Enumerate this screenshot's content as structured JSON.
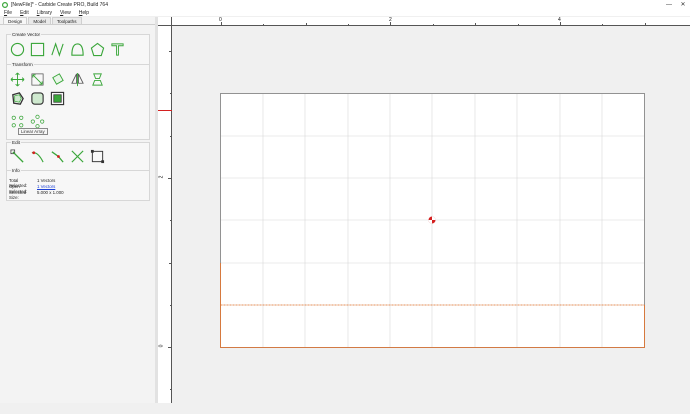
{
  "window": {
    "title": "[NewFile]* - Carbide Create PRO, Build 764",
    "minimize_icon": "minimize-icon",
    "close_icon": "close-icon",
    "minimize_glyph": "—",
    "close_glyph": "✕"
  },
  "menu": {
    "items": [
      "File",
      "Edit",
      "Library",
      "View",
      "Help"
    ]
  },
  "tabs": [
    "Design",
    "Model",
    "Toolpaths"
  ],
  "sections": {
    "create_vector": "Create Vector",
    "transform": "Transform",
    "edit": "Edit",
    "info": "Info"
  },
  "tooltip": "Linear Array",
  "info": {
    "rows": [
      {
        "label": "Total Selected:",
        "value": "1 Vectors"
      },
      {
        "label": "Open Selected:",
        "value": "1 Vectors"
      },
      {
        "label": "Selected Size:",
        "value": "5.000 x 1.000"
      }
    ]
  },
  "ruler": {
    "top_labels": [
      "0",
      "2",
      "4"
    ],
    "left_labels": [
      "2",
      "0"
    ]
  },
  "colors": {
    "accent_green": "#3aa63a",
    "selection_orange": "#e8732a",
    "origin_red": "#d42020",
    "link_blue": "#1b3fd6"
  }
}
